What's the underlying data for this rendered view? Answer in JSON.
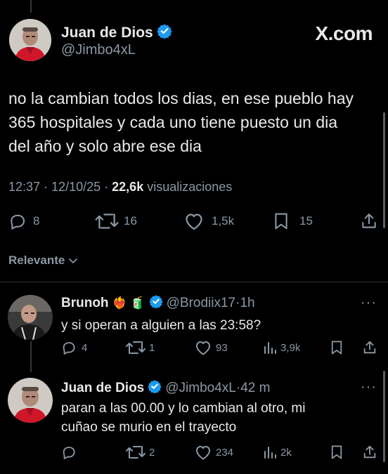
{
  "brand": "X.com",
  "main_tweet": {
    "author_name": "Juan de Dios",
    "author_handle": "@Jimbo4xL",
    "text_lines": [
      "no la cambian todos los dias, en ese pueblo hay",
      "365 hospitales y cada uno tiene puesto un dia",
      "del año y solo abre ese dia"
    ],
    "time": "12:37",
    "date": "12/10/25",
    "views": "22,6k",
    "views_label": "visualizaciones",
    "replies": "8",
    "retweets": "16",
    "likes": "1,5k",
    "bookmarks": "15"
  },
  "sort_label": "Relevante",
  "replies": [
    {
      "author_name": "Brunoh",
      "emojis": "❤️‍🔥 🧃",
      "author_handle": "@Brodiix17",
      "age": "1h",
      "text_lines": [
        "y si operan a alguien a las 23:58?"
      ],
      "replies": "4",
      "retweets": "1",
      "likes": "93",
      "views": "3,9k"
    },
    {
      "author_name": "Juan de Dios",
      "author_handle": "@Jimbo4xL",
      "age": "42 m",
      "text_lines": [
        "paran a las 00.00 y lo cambian al otro, mi",
        "cuñao se murio en el trayecto"
      ],
      "retweets": "2",
      "likes": "234",
      "views": "2k"
    }
  ],
  "colors": {
    "background": "#000000",
    "text": "#e7e9ea",
    "secondary": "#8b98a5",
    "verified": "#1d9bf0",
    "divider": "#2f3336"
  }
}
